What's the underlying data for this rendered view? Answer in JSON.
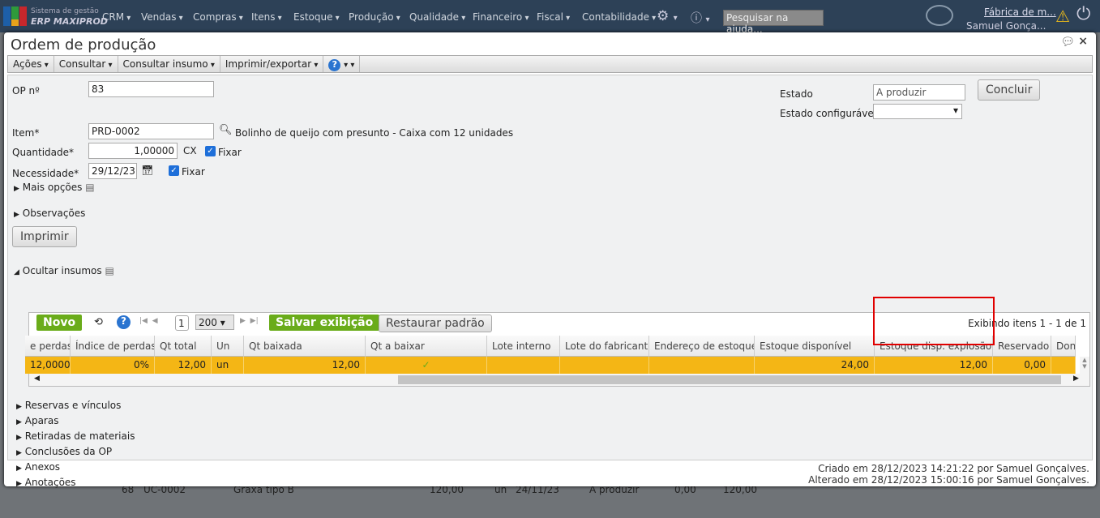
{
  "topbar": {
    "brand_line1": "Sistema de gestão",
    "brand_line2": "ERP MAXIPROD",
    "menu": [
      "CRM",
      "Vendas",
      "Compras",
      "Itens",
      "Estoque",
      "Produção",
      "Qualidade",
      "Financeiro",
      "Fiscal",
      "Contabilidade"
    ],
    "search_placeholder": "Pesquisar na ajuda...",
    "company": "Fábrica de m...",
    "user": "Samuel Gonça..."
  },
  "window": {
    "title": "Ordem de produção",
    "toolbar": [
      "Ações",
      "Consultar",
      "Consultar insumo",
      "Imprimir/exportar"
    ]
  },
  "form": {
    "op_label": "OP nº",
    "op_value": "83",
    "item_label": "Item*",
    "item_value": "PRD-0002",
    "item_desc": "Bolinho de queijo com presunto - Caixa com 12 unidades",
    "qty_label": "Quantidade*",
    "qty_value": "1,00000",
    "qty_unit": "CX",
    "fix_label": "Fixar",
    "need_label": "Necessidade*",
    "need_value": "29/12/23",
    "more_options": "Mais opções",
    "observations": "Observações",
    "print_button": "Imprimir",
    "state_label": "Estado",
    "state_value": "A produzir",
    "conf_state_label": "Estado configurável",
    "conf_state_value": "",
    "conclude_button": "Concluir"
  },
  "inputs_section": {
    "title": "Ocultar insumos",
    "new_button": "Novo",
    "page": "1",
    "page_size": "200",
    "save_view": "Salvar exibição",
    "restore": "Restaurar padrão",
    "showing": "Exibindo itens 1 - 1 de 1",
    "columns": [
      "e perdas",
      "Índice de perdas",
      "Qt total",
      "Un",
      "Qt baixada",
      "Qt a baixar",
      "Lote interno",
      "Lote do fabricante",
      "Endereço de estoque",
      "Estoque disponível",
      "Estoque disp. explosão",
      "Reservado",
      "Don"
    ],
    "row": [
      "12,00000",
      "0%",
      "12,00",
      "un",
      "12,00",
      "",
      "",
      "",
      "",
      "24,00",
      "12,00",
      "0,00",
      ""
    ]
  },
  "sections": [
    "Reservas e vínculos",
    "Aparas",
    "Retiradas de materiais",
    "Conclusões da OP",
    "Anexos",
    "Anotações"
  ],
  "footer": {
    "created": "Criado em 28/12/2023 14:21:22 por Samuel Gonçalves.",
    "altered": "Alterado em 28/12/2023 15:00:16 por Samuel Gonçalves."
  },
  "background_row": [
    "68",
    "UC-0002",
    "Graxa tipo B",
    "120,00",
    "un",
    "24/11/23",
    "A produzir",
    "0,00",
    "120,00"
  ],
  "colors": {
    "topbar": "#2d4157",
    "highlight_row": "#f4b615",
    "green_button": "#6aac1a",
    "annotation_box": "#e00000"
  }
}
